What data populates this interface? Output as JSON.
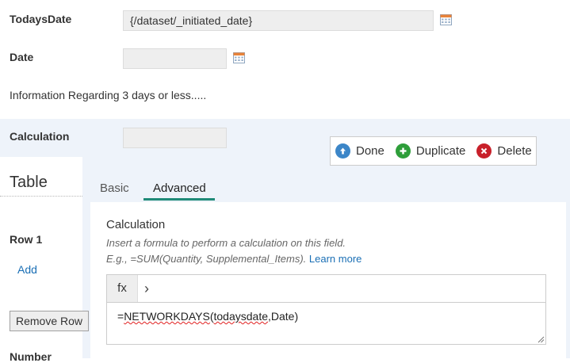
{
  "fields": {
    "todays_date_label": "TodaysDate",
    "todays_date_value": "{/dataset/_initiated_date}",
    "date_label": "Date",
    "date_value": "",
    "info_text": "Information Regarding 3 days or less.....",
    "calculation_label": "Calculation",
    "calculation_value": ""
  },
  "toolbar": {
    "done": "Done",
    "duplicate": "Duplicate",
    "delete": "Delete"
  },
  "table_section": {
    "title": "Table",
    "row_label": "Row 1",
    "add_link": "Add",
    "remove_row": "Remove Row",
    "number_label": "Number"
  },
  "tabs": [
    {
      "label": "Basic",
      "active": false
    },
    {
      "label": "Advanced",
      "active": true
    }
  ],
  "advanced": {
    "heading": "Calculation",
    "help_line1": "Insert a formula to perform a calculation on this field.",
    "help_line2": "E.g., =SUM(Quantity, Supplemental_Items).",
    "learn_more": "Learn more",
    "fx_label": "fx",
    "chevron": "›",
    "formula_prefix": "=",
    "formula_func": "NETWORKDAYS",
    "formula_open": "(",
    "formula_arg1": "todaysdate",
    "formula_rest": ",Date)"
  },
  "icons": {
    "done": "arrow-up-circle-icon",
    "duplicate": "plus-circle-icon",
    "delete": "x-circle-icon",
    "calendar": "calendar-icon"
  },
  "colors": {
    "done_blue": "#3c86c8",
    "duplicate_green": "#2e9e3a",
    "delete_red": "#c8202a",
    "tab_underline": "#1f8a78",
    "panel_bg": "#eef3fa",
    "link": "#1a6fb5"
  }
}
